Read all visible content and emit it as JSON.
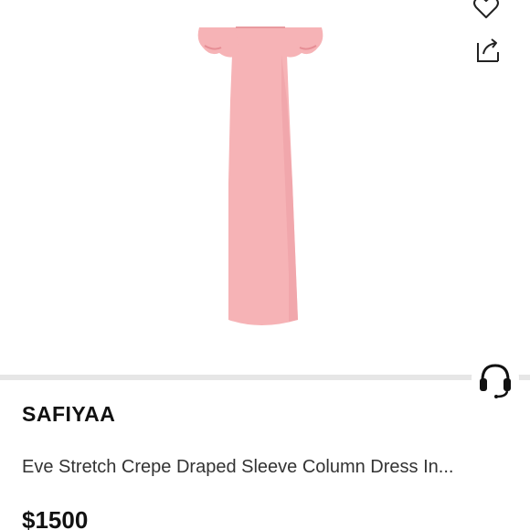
{
  "product": {
    "brand": "SAFIYAA",
    "title": "Eve Stretch Crepe Draped Sleeve Column Dress In...",
    "price": "$1500"
  },
  "icons": {
    "like": "heart-icon",
    "share": "share-icon",
    "support": "headset-icon"
  },
  "colors": {
    "dress": "#f6b3b6",
    "dress_shadow": "#e89a9f",
    "divider": "#e6e6e6"
  }
}
